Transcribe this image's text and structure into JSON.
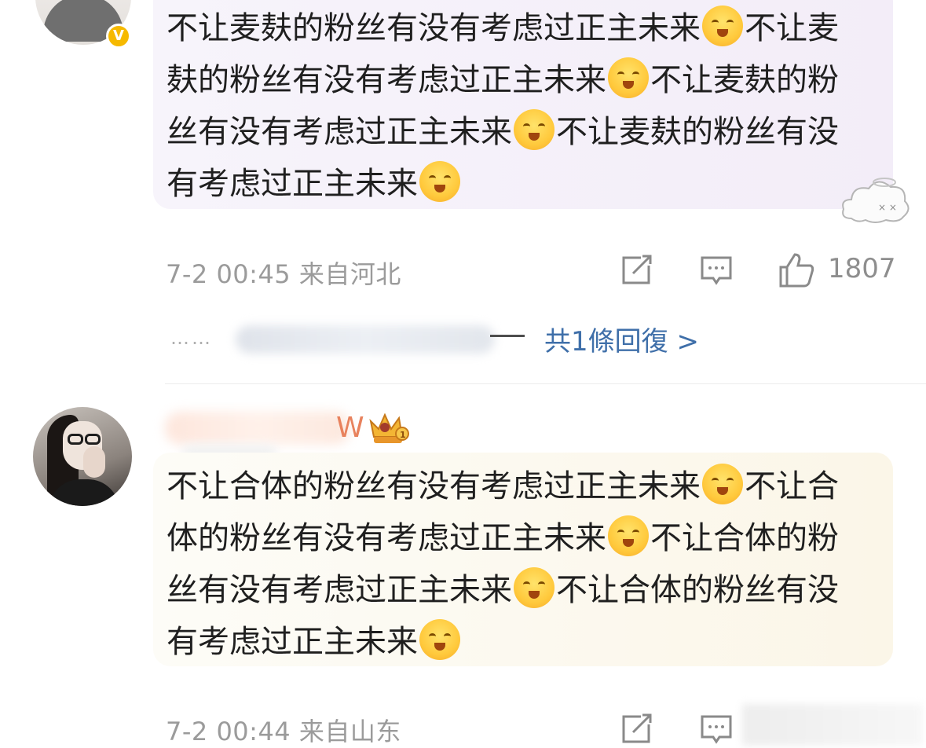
{
  "comments": [
    {
      "text": "不让麦麸的粉丝有没有考虑过正主未来",
      "repeat": 4,
      "emoji": "blush-smile-emoji",
      "date": "7-2 00:45",
      "location": "来自河北",
      "likes": "1807",
      "badge": "V",
      "reply_link": "共1條回復 >",
      "reply_dots": "……"
    },
    {
      "username_visible_tail": "W",
      "text": "不让合体的粉丝有没有考虑过正主未来",
      "repeat": 4,
      "emoji": "blush-smile-emoji",
      "date": "7-2 00:44",
      "location": "来自山东"
    }
  ],
  "icons": {
    "repost": "repost-icon",
    "comment": "comment-icon",
    "like": "thumbs-up-icon",
    "crown": "crown-level-icon",
    "sticker": "dizzy-cloud-sticker"
  },
  "colors": {
    "link": "#3f6fa9",
    "meta": "#9b9b9b",
    "badge": "#f6b900",
    "bubble1": "#f3edf8",
    "bubble2": "#fbf6e8"
  }
}
